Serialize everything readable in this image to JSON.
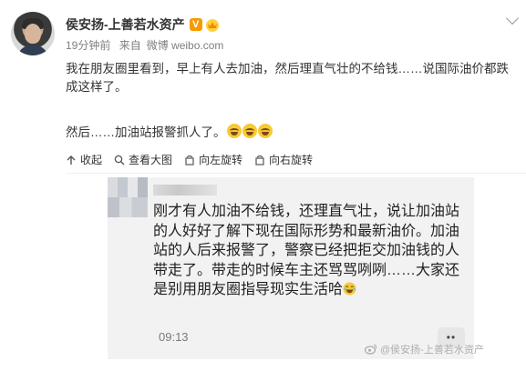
{
  "post": {
    "author": "侯安扬-上善若水资产",
    "vip_badge": "V",
    "time": "19分钟前",
    "source_prefix": "来自",
    "source": "微博 weibo.com",
    "text_line1": "我在朋友圈里看到，早上有人去加油，然后理直气壮的不给钱……说国际油价都跌成这样了。",
    "text_line2": "然后……加油站报警抓人了。"
  },
  "toolbar": {
    "collapse": "收起",
    "view_large": "查看大图",
    "rotate_left": "向左旋转",
    "rotate_right": "向右旋转"
  },
  "card": {
    "text": "刚才有人加油不给钱，还理直气壮，说让加油站的人好好了解下现在国际形势和最新油价。加油站的人后来报警了，警察已经把拒交加油钱的人带走了。带走的时候车主还骂骂咧咧……大家还是别用朋友圈指导现实生活哈",
    "time": "09:13",
    "more": "••"
  },
  "watermark": "@侯安扬-上善若水资产",
  "colors": {
    "accent": "#f79a00",
    "card_bg": "#f2f2f2",
    "meta": "#808080"
  }
}
